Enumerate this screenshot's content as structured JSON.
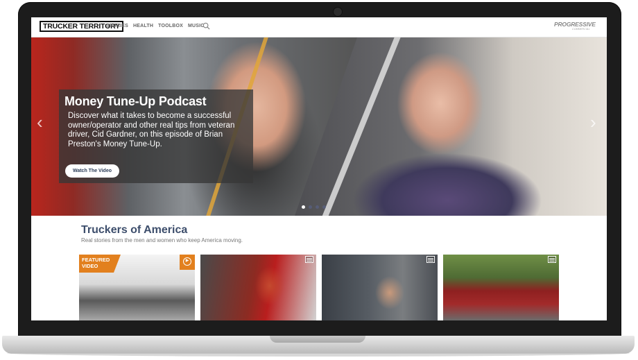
{
  "nav": {
    "logo": "TRUCKER TERRITORY",
    "items": [
      "STORIES",
      "HEALTH",
      "TOOLBOX",
      "MUSIC"
    ],
    "brand": "PROGRESSIVE",
    "brand_sub": "COMMERCIAL"
  },
  "hero": {
    "title": "Money Tune-Up Podcast",
    "description": "Discover what it takes to become a successful owner/operator and other real tips from veteran driver, Cid Gardner, on this episode of Brian Preston's Money Tune-Up.",
    "button": "Watch The Video",
    "prev_arrow": "‹",
    "next_arrow": "›",
    "slides": 4,
    "active_slide": 1
  },
  "section": {
    "title": "Truckers of America",
    "subtitle": "Real stories from the men and women who keep America moving."
  },
  "cards": [
    {
      "badge": "FEATURED VIDEO",
      "icon": "play-icon"
    },
    {
      "icon": "gallery-icon"
    },
    {
      "icon": "gallery-icon"
    },
    {
      "icon": "gallery-icon"
    }
  ]
}
